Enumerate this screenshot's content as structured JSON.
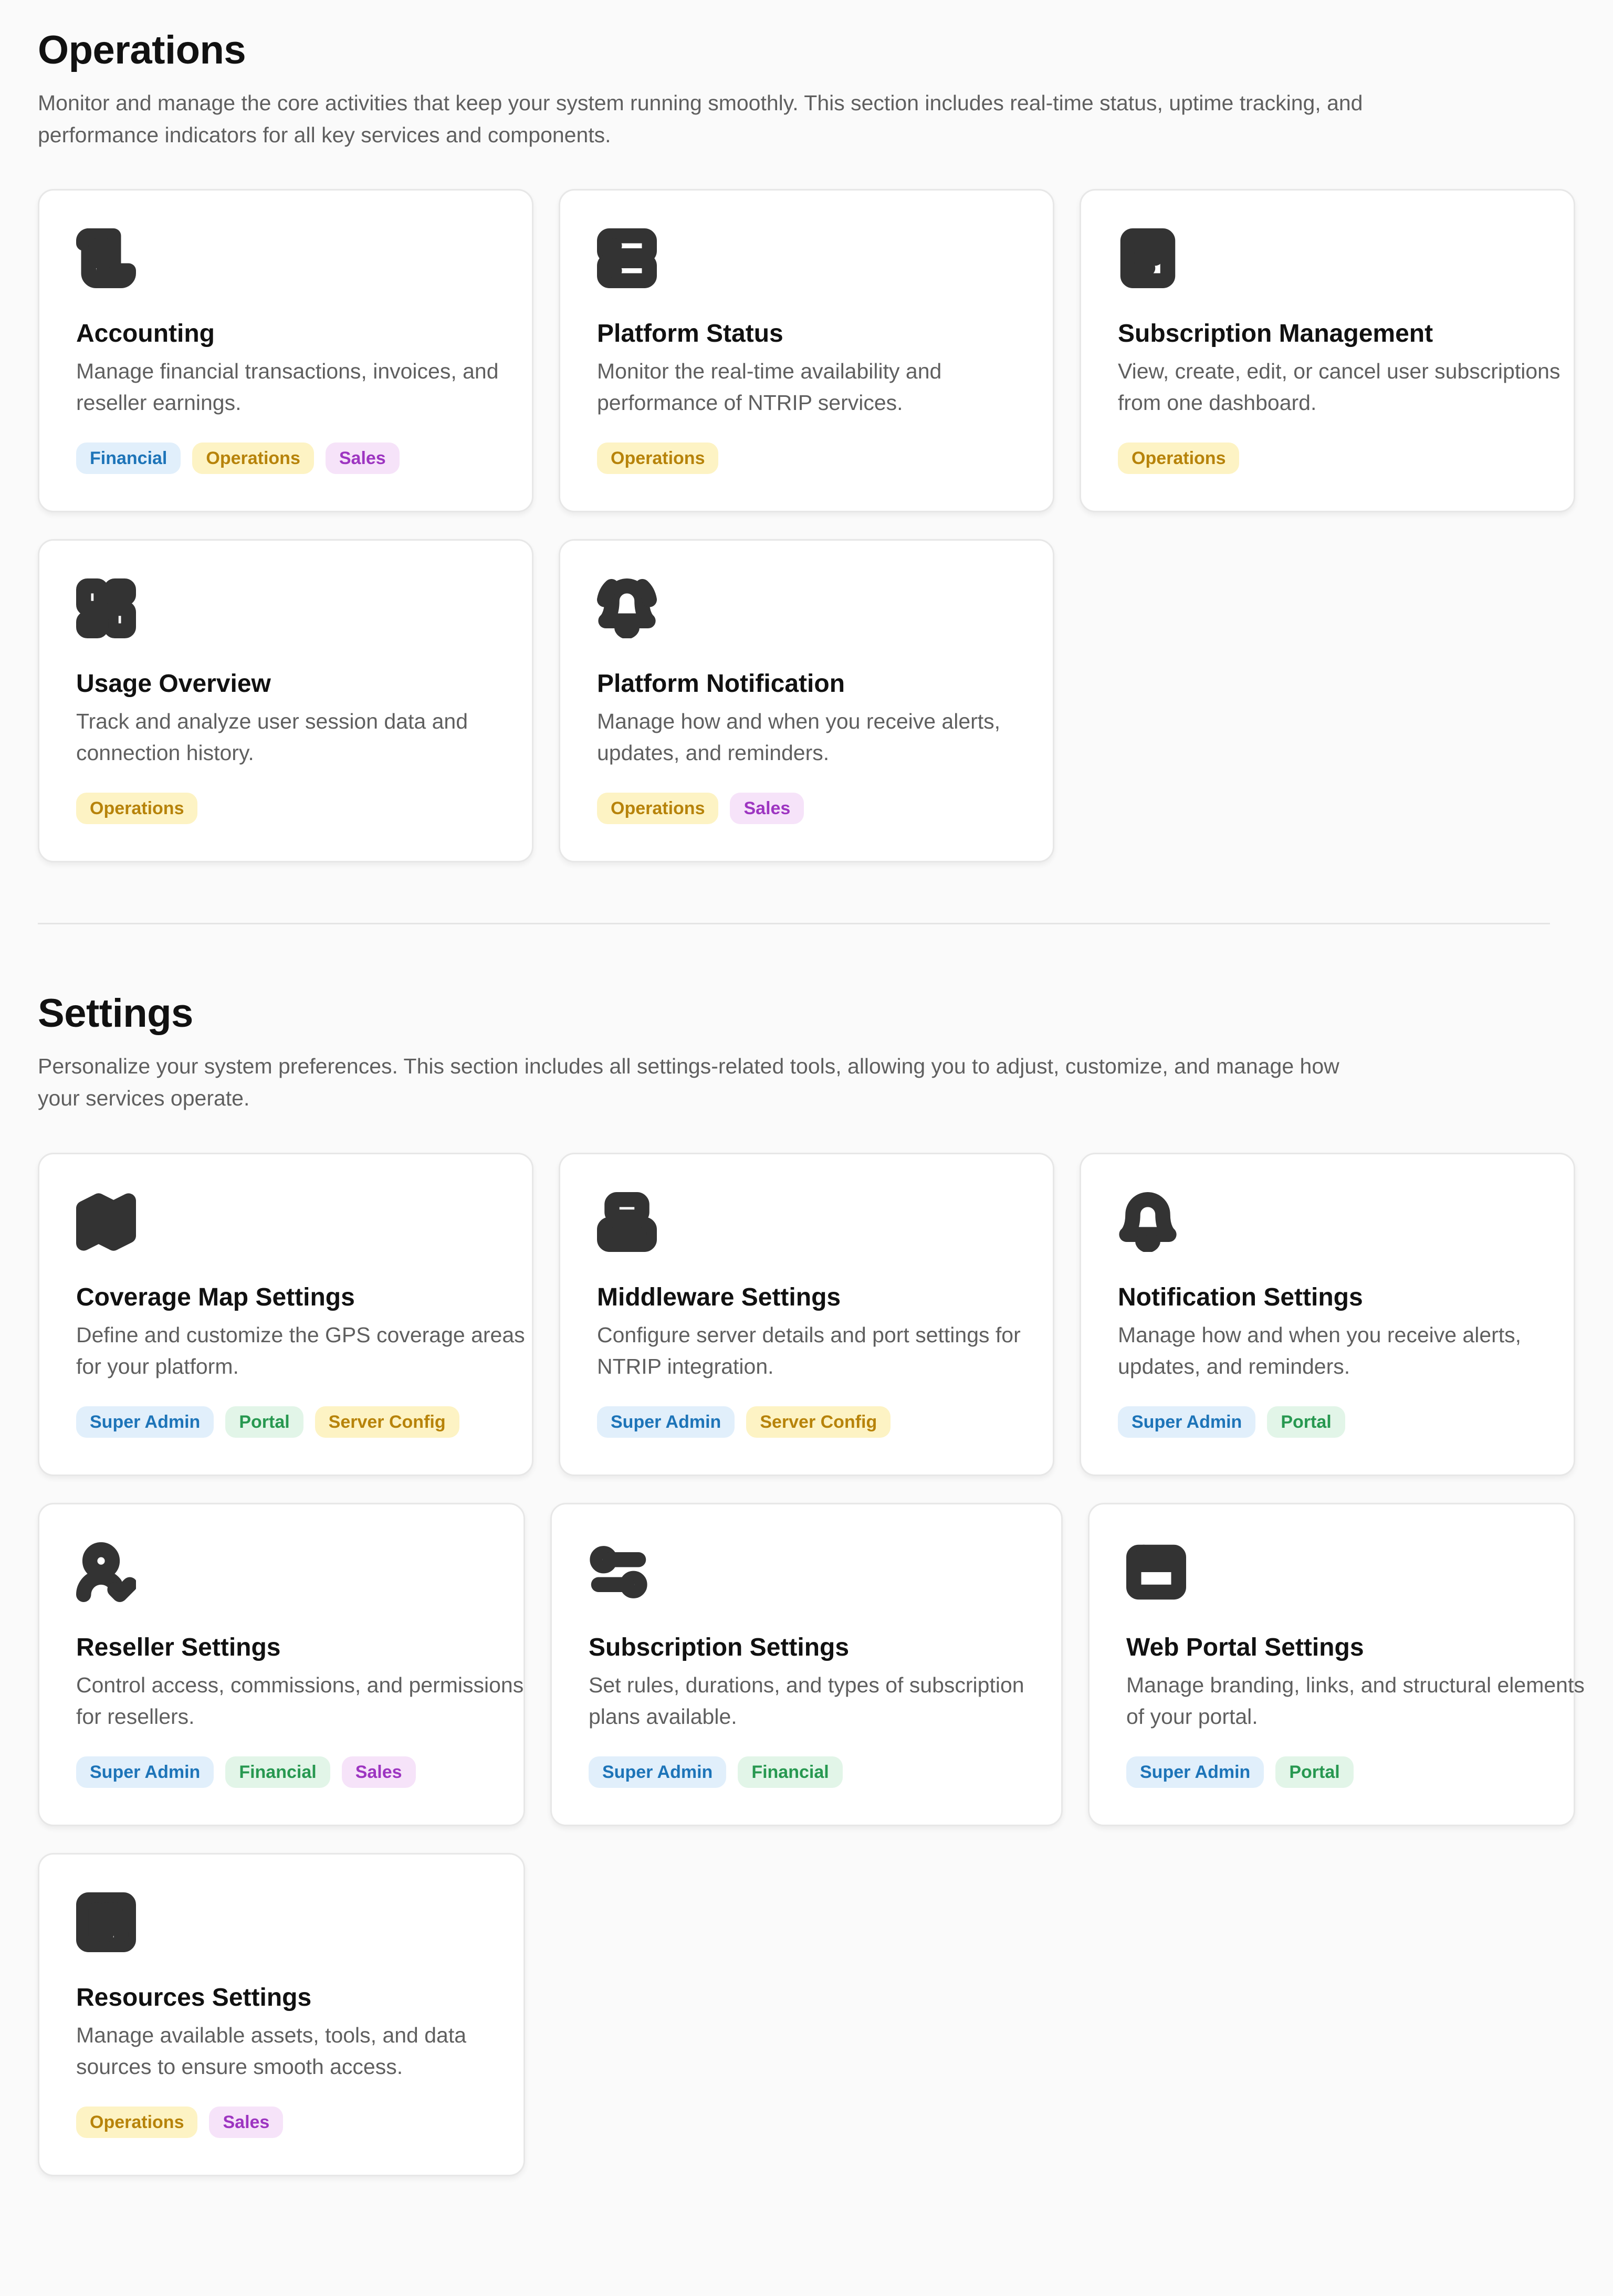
{
  "operations": {
    "title": "Operations",
    "description": "Monitor and manage the core activities that keep your system running smoothly. This section includes real-time status, uptime tracking, and performance indicators for all key services and components.",
    "cards": [
      {
        "title": "Accounting",
        "description": "Manage financial transactions, invoices, and reseller earnings.",
        "icon": "scroll-icon",
        "tags": [
          "Financial",
          "Operations",
          "Sales"
        ]
      },
      {
        "title": "Platform Status",
        "description": "Monitor the real-time availability and performance of NTRIP services.",
        "icon": "server-icon",
        "tags": [
          "Operations"
        ]
      },
      {
        "title": "Subscription Management",
        "description": "View, create, edit, or cancel user subscriptions from one dashboard.",
        "icon": "document-icon",
        "tags": [
          "Operations"
        ]
      },
      {
        "title": "Usage Overview",
        "description": "Track and analyze user session data and connection history.",
        "icon": "dashboard-icon",
        "tags": [
          "Operations"
        ]
      },
      {
        "title": "Platform Notification",
        "description": "Manage how and when you receive alerts, updates, and reminders.",
        "icon": "bell-ringing-icon",
        "tags": [
          "Operations",
          "Sales"
        ]
      }
    ]
  },
  "settings": {
    "title": "Settings",
    "description": "Personalize your system preferences. This section includes all settings-related tools, allowing you to adjust, customize, and manage how your services operate.",
    "cards": [
      {
        "title": "Coverage Map Settings",
        "description": "Define and customize the GPS coverage areas for your platform.",
        "icon": "map-icon",
        "tags": [
          "Super Admin",
          "Portal",
          "Server Config"
        ]
      },
      {
        "title": "Middleware Settings",
        "description": "Configure server details and port settings for NTRIP integration.",
        "icon": "middleware-icon",
        "tags": [
          "Super Admin",
          "Server Config"
        ]
      },
      {
        "title": "Notification Settings",
        "description": "Manage how and when you receive alerts, updates, and reminders.",
        "icon": "bell-icon",
        "tags": [
          "Super Admin",
          "Portal"
        ]
      },
      {
        "title": "Reseller Settings",
        "description": "Control access, commissions, and permissions for resellers.",
        "icon": "user-check-icon",
        "tags": [
          "Super Admin",
          "Financial",
          "Sales"
        ]
      },
      {
        "title": "Subscription Settings",
        "description": "Set rules, durations, and types of subscription plans available.",
        "icon": "sliders-icon",
        "tags": [
          "Super Admin",
          "Financial"
        ]
      },
      {
        "title": "Web Portal Settings",
        "description": "Manage branding, links, and structural elements of your portal.",
        "icon": "browser-icon",
        "tags": [
          "Super Admin",
          "Portal"
        ]
      },
      {
        "title": "Resources Settings",
        "description": "Manage available assets, tools, and data sources to ensure smooth access.",
        "icon": "library-icon",
        "tags": [
          "Operations",
          "Sales"
        ]
      }
    ]
  },
  "tag_colors": {
    "Financial": "#1d74b8",
    "Super Admin": "#1d74b8",
    "Operations": "#b7830a",
    "Server Config": "#b7830a",
    "Sales": "#9d35c1",
    "Portal": "#279850"
  }
}
